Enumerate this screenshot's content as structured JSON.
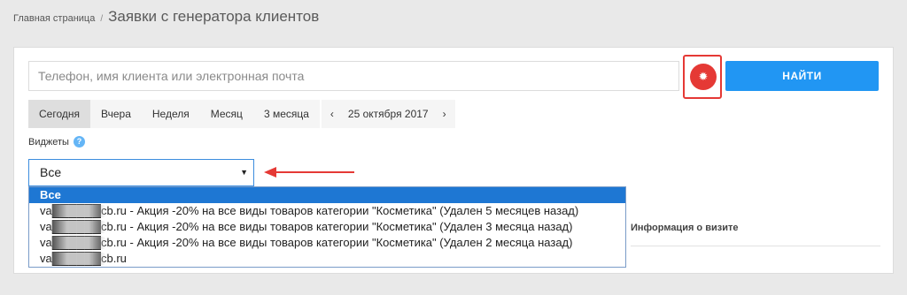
{
  "breadcrumb": {
    "home": "Главная страница",
    "separator": "/",
    "title": "Заявки с генератора клиентов"
  },
  "search": {
    "placeholder": "Телефон, имя клиента или электронная почта",
    "value": "",
    "find_label": "НАЙТИ",
    "settings_icon": "gear-icon"
  },
  "periods": [
    "Сегодня",
    "Вчера",
    "Неделя",
    "Месяц",
    "3 месяца"
  ],
  "active_period": "Сегодня",
  "date_nav": {
    "prev": "‹",
    "date": "25 октября 2017",
    "next": "›"
  },
  "widgets": {
    "label": "Виджеты",
    "help": "?",
    "selected": "Все",
    "options": [
      "Все",
      "va██████cb.ru - Акция -20% на все виды товаров категории \"Косметика\" (Удален 5 месяцев назад)",
      "va██████cb.ru - Акция -20% на все виды товаров категории \"Косметика\" (Удален 3 месяца назад)",
      "va██████cb.ru - Акция -20% на все виды товаров категории \"Косметика\" (Удален 2 месяца назад)",
      "va██████cb.ru"
    ]
  },
  "table": {
    "visit_info_header": "Информация о визите"
  },
  "colors": {
    "accent_blue": "#2196f3",
    "settings_red": "#e53935",
    "option_highlight": "#1e77d3"
  }
}
